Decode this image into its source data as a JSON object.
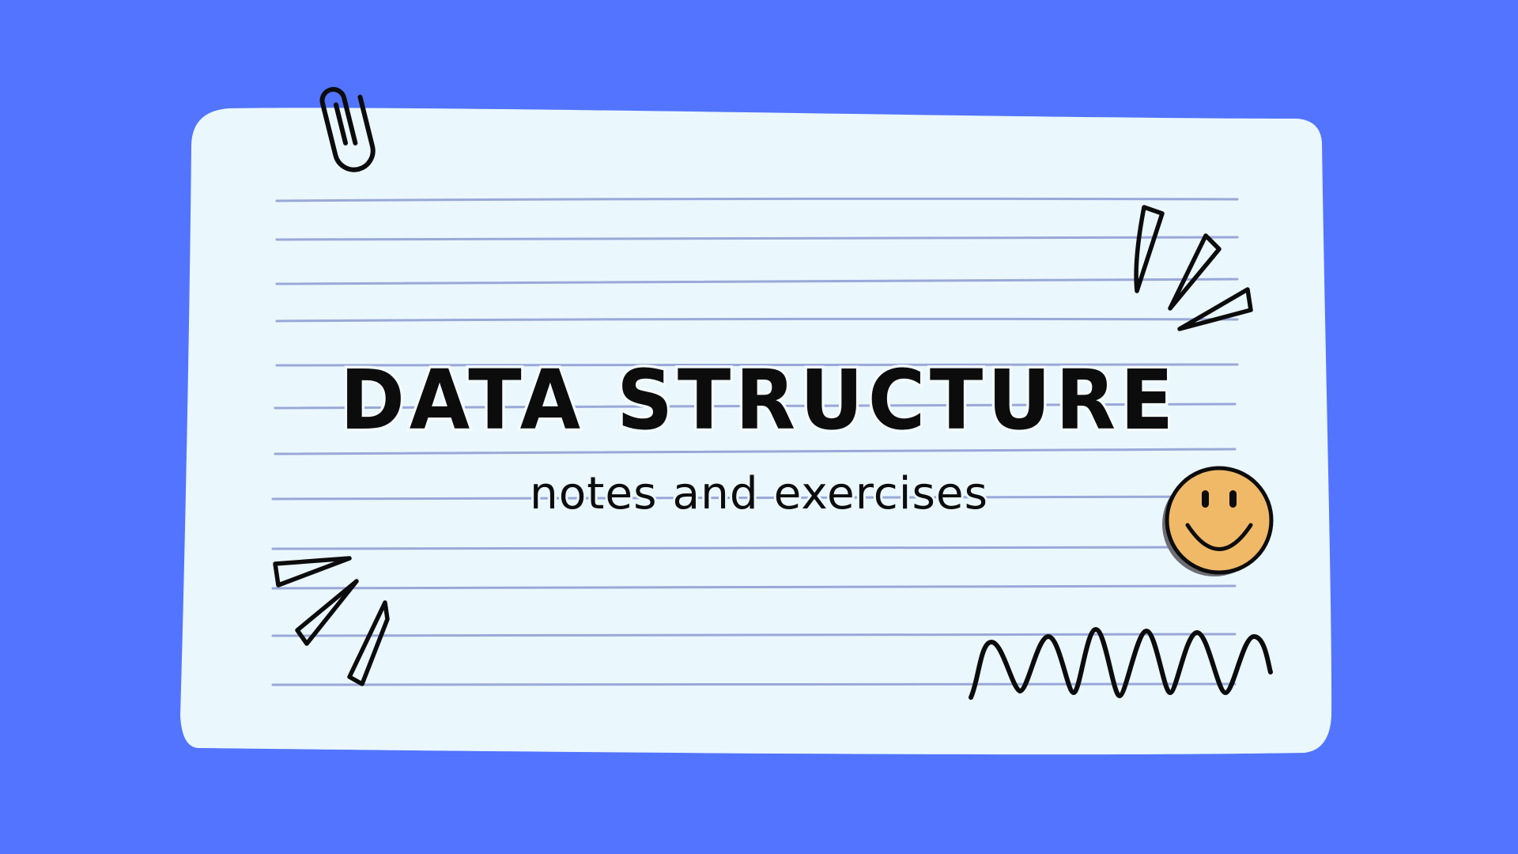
{
  "slide": {
    "title": "DATA STRUCTURE",
    "subtitle": "notes and exercises"
  },
  "colors": {
    "background": "#5274ff",
    "paper": "#eaf7fd",
    "rule_lines": "#9aa8d8",
    "ink": "#0c0c0c",
    "smiley": "#f0b968"
  },
  "decorations": {
    "paper_clip": "paper-clip-icon",
    "emphasis_marks": "emphasis-marks-icon",
    "smiley": "smiley-face-icon",
    "zigzag": "zigzag-scribble-icon"
  }
}
